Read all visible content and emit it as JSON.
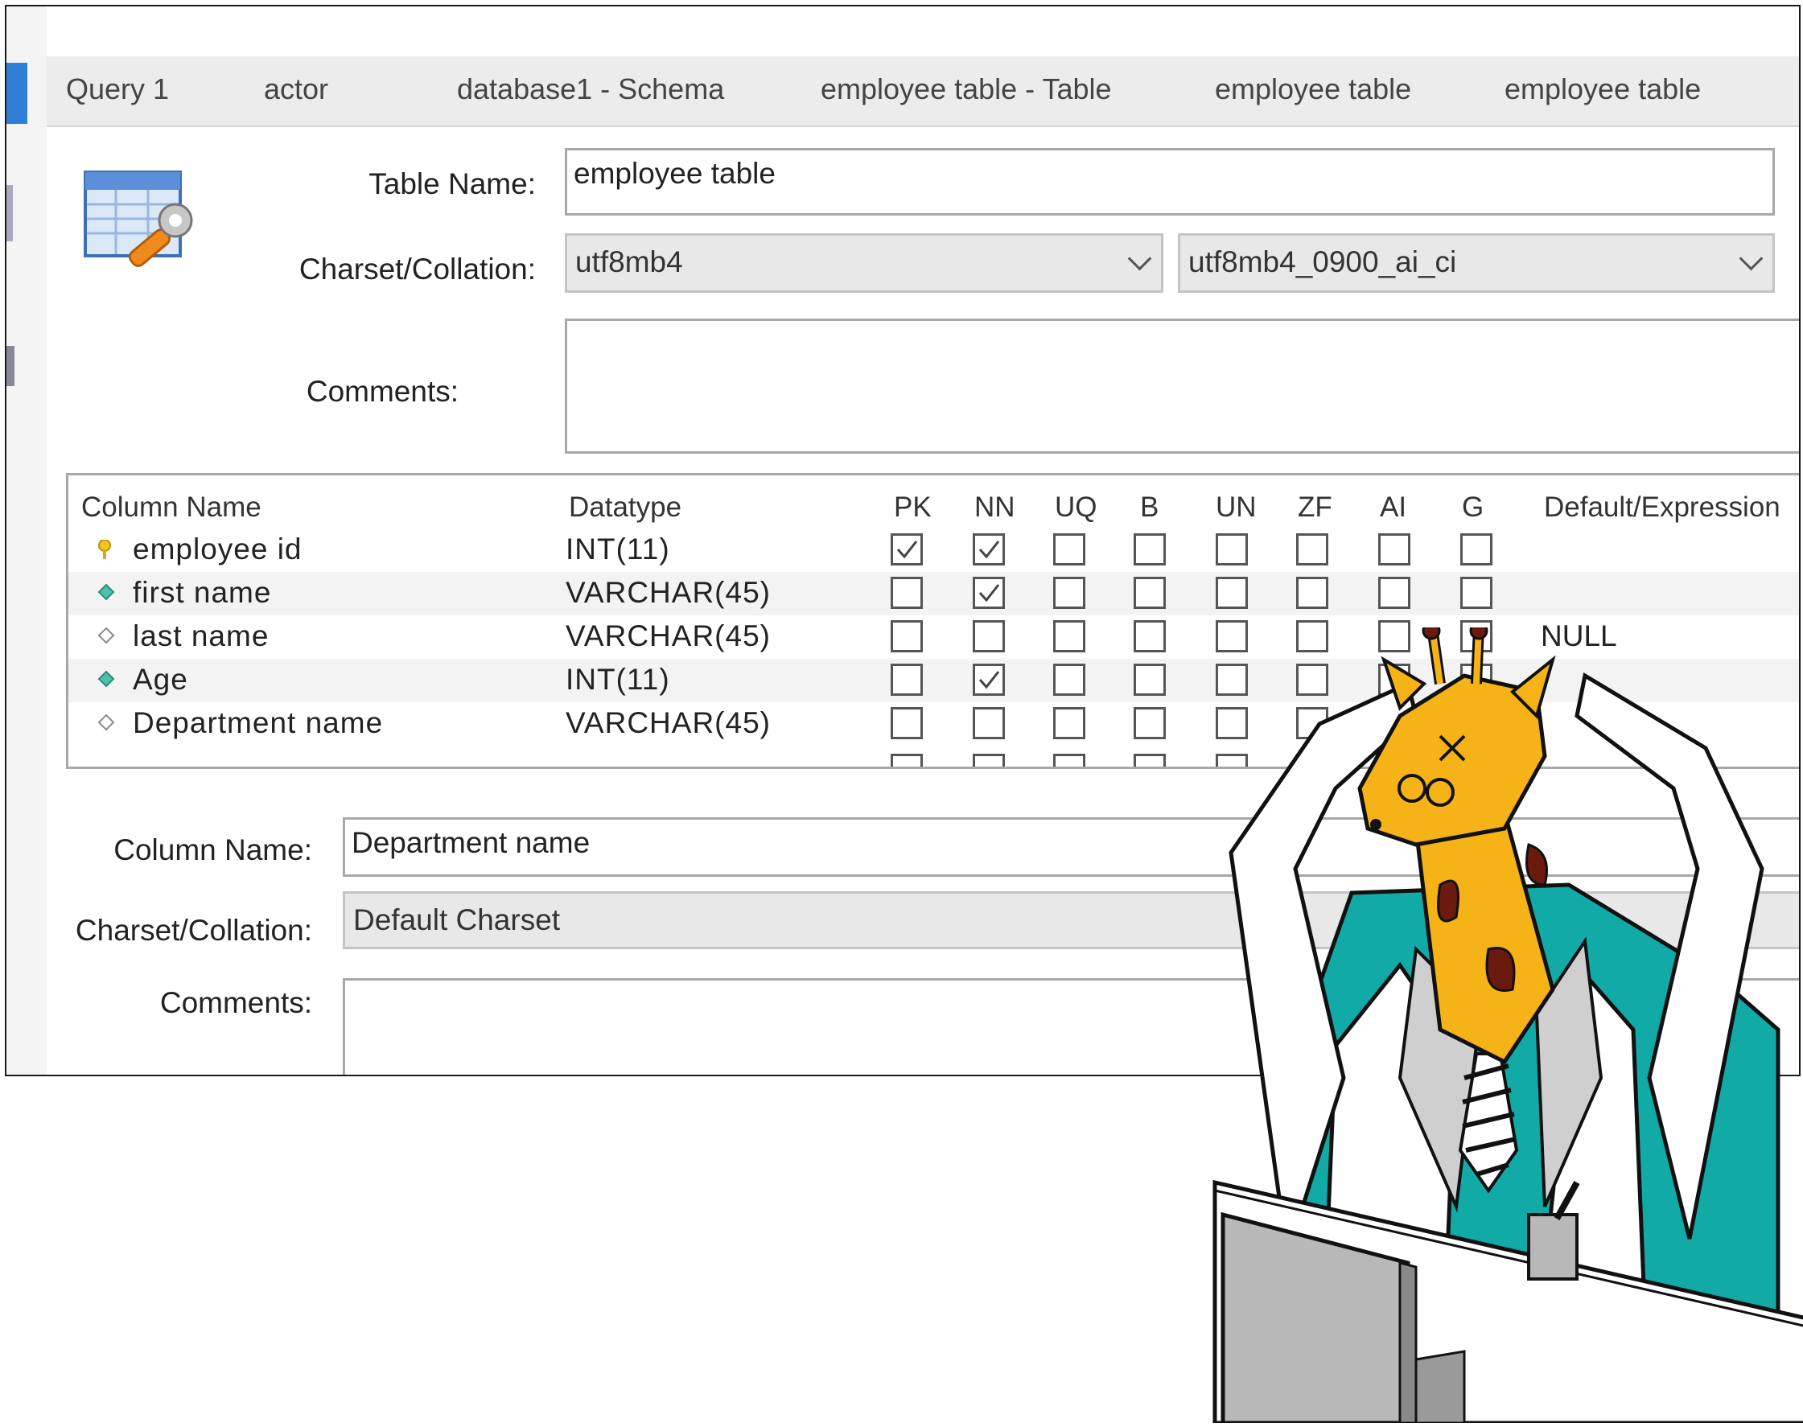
{
  "tabs": [
    "Query 1",
    "actor",
    "database1 - Schema",
    "employee table - Table",
    "employee table",
    "employee table"
  ],
  "table_form": {
    "table_name_label": "Table Name:",
    "table_name_value": "employee table",
    "charset_label": "Charset/Collation:",
    "charset_value": "utf8mb4",
    "collation_value": "utf8mb4_0900_ai_ci",
    "comments_label": "Comments:"
  },
  "grid": {
    "headers": [
      "Column Name",
      "Datatype",
      "PK",
      "NN",
      "UQ",
      "B",
      "UN",
      "ZF",
      "AI",
      "G",
      "Default/Expression"
    ],
    "rows": [
      {
        "name": "employee id",
        "type": "INT(11)",
        "icon": "key-icon",
        "flags": [
          true,
          true,
          false,
          false,
          false,
          false,
          false,
          false
        ],
        "default": ""
      },
      {
        "name": "first name",
        "type": "VARCHAR(45)",
        "icon": "filled-diamond-icon",
        "flags": [
          false,
          true,
          false,
          false,
          false,
          false,
          false,
          false
        ],
        "default": ""
      },
      {
        "name": "last name",
        "type": "VARCHAR(45)",
        "icon": "hollow-diamond-icon",
        "flags": [
          false,
          false,
          false,
          false,
          false,
          false,
          false,
          false
        ],
        "default": "NULL"
      },
      {
        "name": "Age",
        "type": "INT(11)",
        "icon": "filled-diamond-icon",
        "flags": [
          false,
          true,
          false,
          false,
          false,
          false,
          false,
          false
        ],
        "default": ""
      },
      {
        "name": "Department name",
        "type": "VARCHAR(45)",
        "icon": "hollow-diamond-icon",
        "flags": [
          false,
          false,
          false,
          false,
          false,
          false,
          false,
          false
        ],
        "default": ""
      }
    ]
  },
  "column_form": {
    "column_name_label": "Column Name:",
    "column_name_value": "Department name",
    "charset_label": "Charset/Collation:",
    "charset_value": "Default Charset",
    "comments_label": "Comments:"
  },
  "colors": {
    "accent": "#2f7fd6",
    "giraffe_yellow": "#f6b318",
    "giraffe_spot": "#6b1a0e",
    "suit_teal": "#12aaa6"
  }
}
